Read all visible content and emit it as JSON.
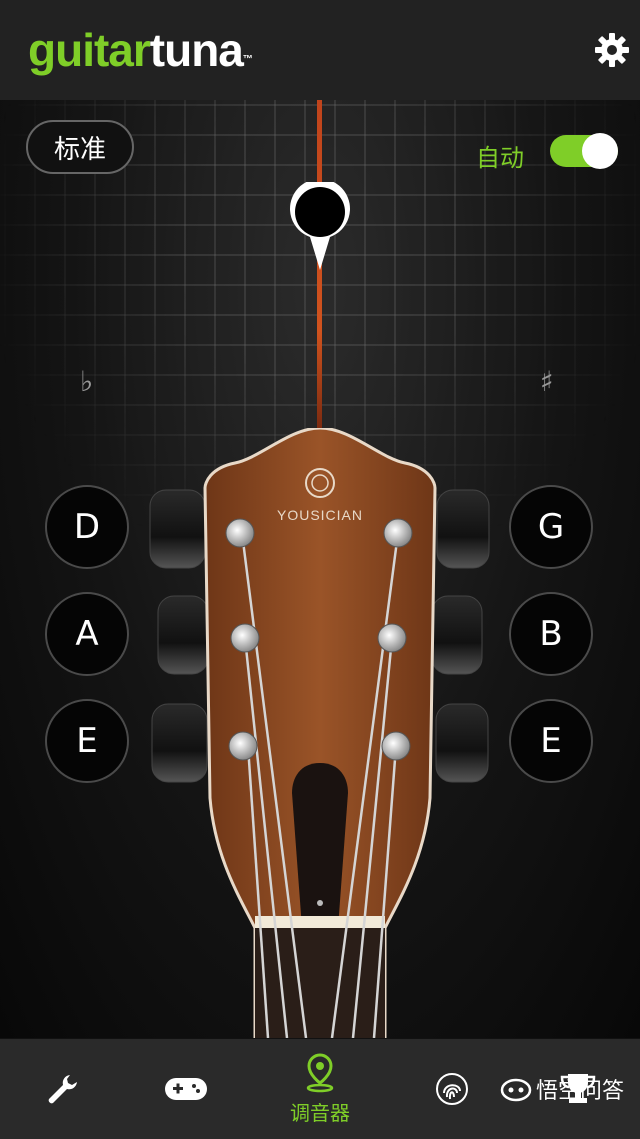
{
  "header": {
    "logo_part1": "guitar",
    "logo_part2": "tuna",
    "logo_tm": "™",
    "settings_icon": "gear-icon"
  },
  "tuner": {
    "tuning_label": "标准",
    "auto_label": "自动",
    "auto_enabled": true,
    "flat_symbol": "♭",
    "sharp_symbol": "♯",
    "headstock_brand": "YOUSICIAN"
  },
  "strings": {
    "left": [
      "D",
      "A",
      "E"
    ],
    "right": [
      "G",
      "B",
      "E"
    ]
  },
  "nav": {
    "items": [
      {
        "icon": "wrench-icon",
        "label": ""
      },
      {
        "icon": "gamepad-icon",
        "label": ""
      },
      {
        "icon": "tuner-pin-icon",
        "label": "调音器"
      },
      {
        "icon": "fingerprint-icon",
        "label": ""
      },
      {
        "icon": "trophy-icon",
        "label": ""
      }
    ]
  },
  "watermark": {
    "text": "悟空问答"
  },
  "colors": {
    "accent": "#7fce28",
    "needle": "#d0531e",
    "header_bg": "#222222",
    "wood": "#8a4a22"
  }
}
